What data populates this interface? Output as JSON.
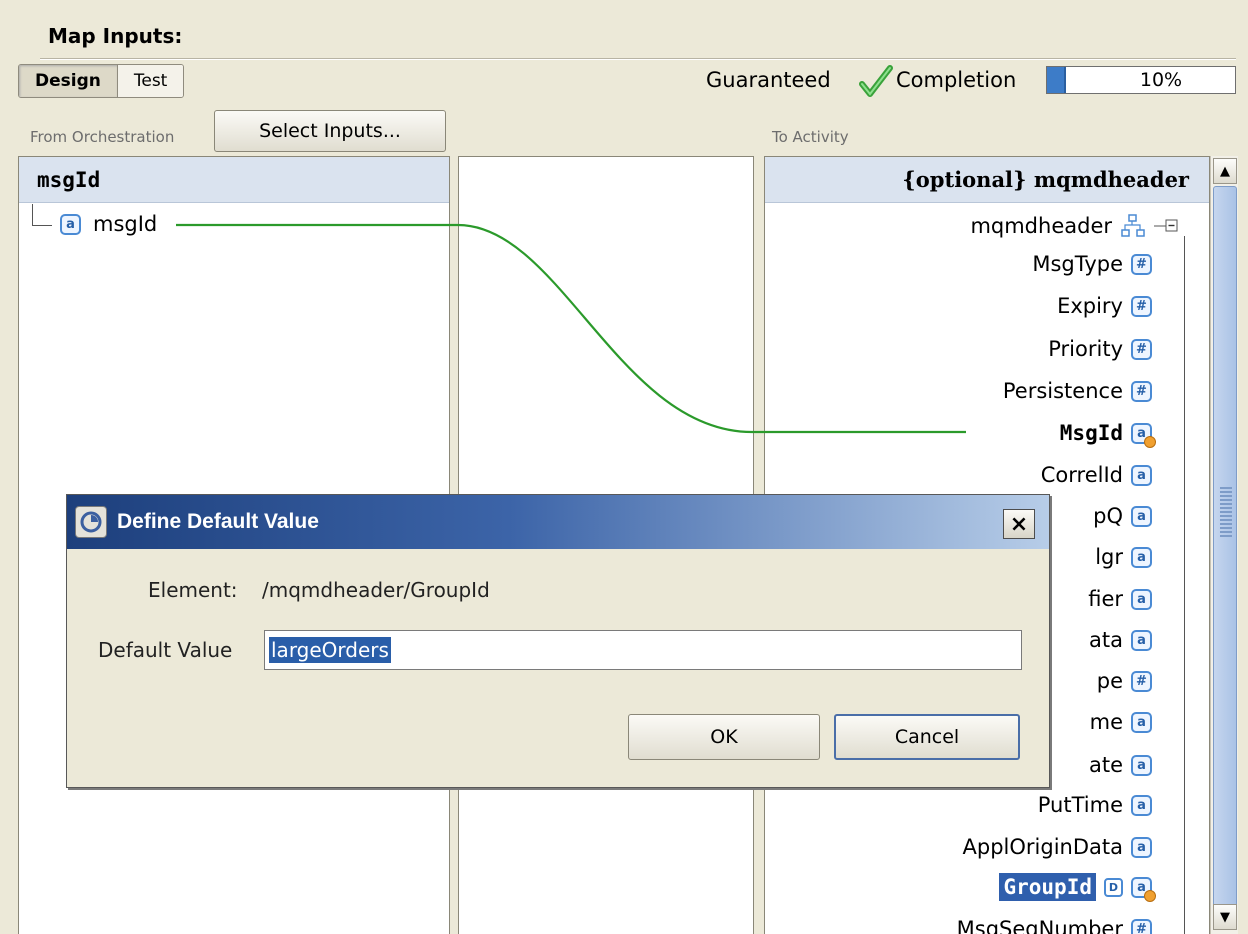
{
  "header": {
    "title": "Map Inputs:"
  },
  "mode_tabs": [
    {
      "label": "Design",
      "active": true
    },
    {
      "label": "Test",
      "active": false
    }
  ],
  "status": {
    "guaranteed_label": "Guaranteed",
    "completion_label": "Completion",
    "completion_percent": 10,
    "completion_text": "10%"
  },
  "from_panel": {
    "label": "From Orchestration",
    "select_button": "Select Inputs...",
    "header": "msgId",
    "items": [
      {
        "label": "msgId",
        "type": "a"
      }
    ]
  },
  "to_panel": {
    "label": "To Activity",
    "header": "{optional} mqmdheader",
    "items": [
      {
        "label": "mqmdheader",
        "type": "tree"
      },
      {
        "label": "MsgType",
        "type": "#"
      },
      {
        "label": "Expiry",
        "type": "#"
      },
      {
        "label": "Priority",
        "type": "#"
      },
      {
        "label": "Persistence",
        "type": "#"
      },
      {
        "label": "MsgId",
        "type": "a"
      },
      {
        "label": "CorrelId",
        "type": "a"
      },
      {
        "label": "pQ",
        "type": "a"
      },
      {
        "label": "lgr",
        "type": "a"
      },
      {
        "label": "fier",
        "type": "a"
      },
      {
        "label": "ata",
        "type": "a"
      },
      {
        "label": "pe",
        "type": "#"
      },
      {
        "label": "me",
        "type": "a"
      },
      {
        "label": "ate",
        "type": "a"
      },
      {
        "label": "PutTime",
        "type": "a"
      },
      {
        "label": "ApplOriginData",
        "type": "a"
      },
      {
        "label": "GroupId",
        "type": "a"
      },
      {
        "label": "MsgSeqNumber",
        "type": "#"
      }
    ]
  },
  "dialog": {
    "title": "Define Default Value",
    "close_glyph": "×",
    "element_label": "Element:",
    "element_value": "/mqmdheader/GroupId",
    "default_label": "Default Value",
    "default_value": "largeOrders",
    "ok_label": "OK",
    "cancel_label": "Cancel"
  },
  "icons": {
    "attribute": "a",
    "number": "#",
    "default": "D"
  },
  "colors": {
    "mapping_line": "#2b9a2b",
    "selection": "#2f5fad",
    "progress": "#3d7cc8"
  }
}
